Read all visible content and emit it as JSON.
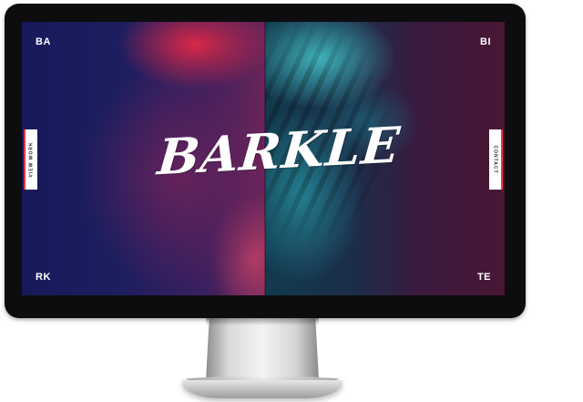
{
  "site": {
    "brand": "BARKLE",
    "corners": {
      "top_left": "BA",
      "top_right": "BI",
      "bottom_left": "RK",
      "bottom_right": "TE"
    },
    "side_tabs": {
      "left": "VIEW WORK",
      "right": "CONTACT"
    },
    "theme": {
      "left_tint": "#1b1d52",
      "left_accent": "#e1284a",
      "right_tint": "#4a1634",
      "right_accent": "#46c8cd",
      "tab_accent": "#e8353f"
    }
  }
}
